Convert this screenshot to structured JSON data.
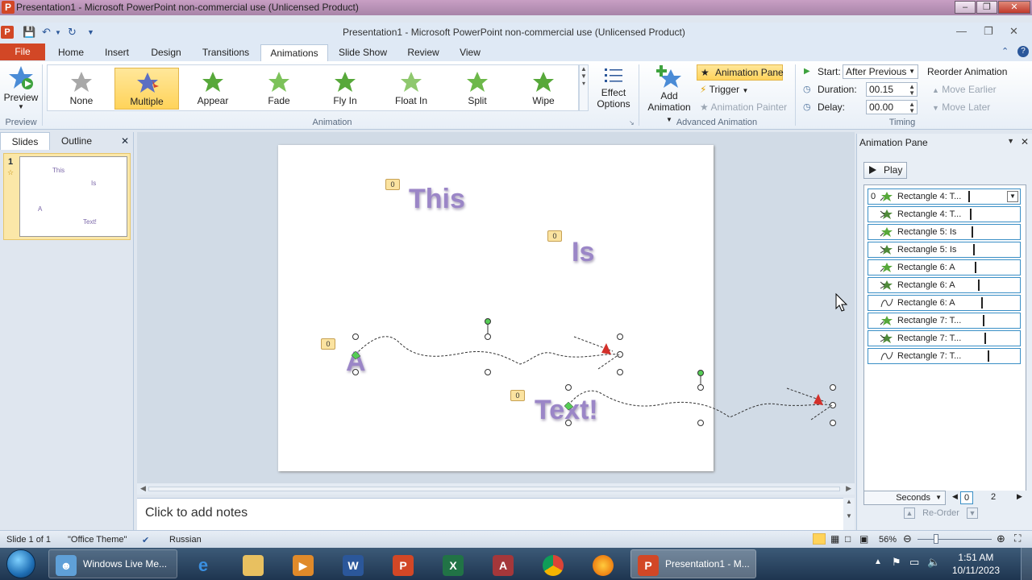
{
  "window": {
    "title": "Presentation1 - Microsoft PowerPoint non-commercial use (Unlicensed Product)",
    "app_title": "Presentation1  -  Microsoft PowerPoint non-commercial use (Unlicensed Product)",
    "logo_letter": "P"
  },
  "tabs": [
    "File",
    "Home",
    "Insert",
    "Design",
    "Transitions",
    "Animations",
    "Slide Show",
    "Review",
    "View"
  ],
  "active_tab": "Animations",
  "ribbon": {
    "preview_label": "Preview",
    "preview_group": "Preview",
    "gallery": [
      "None",
      "Multiple",
      "Appear",
      "Fade",
      "Fly In",
      "Float In",
      "Split",
      "Wipe"
    ],
    "gallery_selected": "Multiple",
    "effect_options_1": "Effect",
    "effect_options_2": "Options",
    "animation_group": "Animation",
    "add_animation_1": "Add",
    "add_animation_2": "Animation",
    "animation_pane": "Animation Pane",
    "trigger": "Trigger",
    "animation_painter": "Animation Painter",
    "advanced_group": "Advanced Animation",
    "start_label": "Start:",
    "start_value": "After Previous",
    "duration_label": "Duration:",
    "duration_value": "00.15",
    "delay_label": "Delay:",
    "delay_value": "00.00",
    "timing_group": "Timing",
    "reorder_title": "Reorder Animation",
    "move_earlier": "Move Earlier",
    "move_later": "Move Later"
  },
  "slides_panel": {
    "tab_slides": "Slides",
    "tab_outline": "Outline",
    "slide_number": "1",
    "thumb_texts": [
      "This",
      "Is",
      "A",
      "Text!"
    ]
  },
  "slide": {
    "words": [
      "This",
      "Is",
      "A",
      "Text!"
    ],
    "badge": "0"
  },
  "notes_placeholder": "Click to add notes",
  "animation_pane": {
    "title": "Animation Pane",
    "play": "Play",
    "first_num": "0",
    "items": [
      {
        "name": "Rectangle 4: T...",
        "icon": "star-icon"
      },
      {
        "name": "Rectangle 4: T...",
        "icon": "star-multi-icon"
      },
      {
        "name": "Rectangle 5: Is",
        "icon": "star-icon"
      },
      {
        "name": "Rectangle 5: Is",
        "icon": "star-multi-icon"
      },
      {
        "name": "Rectangle 6: A",
        "icon": "star-icon"
      },
      {
        "name": "Rectangle 6: A",
        "icon": "star-multi-icon"
      },
      {
        "name": "Rectangle 6: A",
        "icon": "motion-path-icon"
      },
      {
        "name": "Rectangle 7: T...",
        "icon": "star-icon"
      },
      {
        "name": "Rectangle 7: T...",
        "icon": "star-multi-icon"
      },
      {
        "name": "Rectangle 7: T...",
        "icon": "motion-path-icon"
      }
    ],
    "seconds": "Seconds",
    "timeline_start": "0",
    "timeline_end": "2",
    "reorder": "Re-Order"
  },
  "statusbar": {
    "slide_info": "Slide 1 of 1",
    "theme": "\"Office Theme\"",
    "language": "Russian",
    "zoom": "56%"
  },
  "taskbar": {
    "windows_live": "Windows Live Me...",
    "presentation": "Presentation1 - M...",
    "time": "1:51 AM",
    "date": "10/11/2023"
  },
  "colors": {
    "accent": "#d24726",
    "slide_text": "#9b86c7",
    "selection": "#ffd35a"
  }
}
